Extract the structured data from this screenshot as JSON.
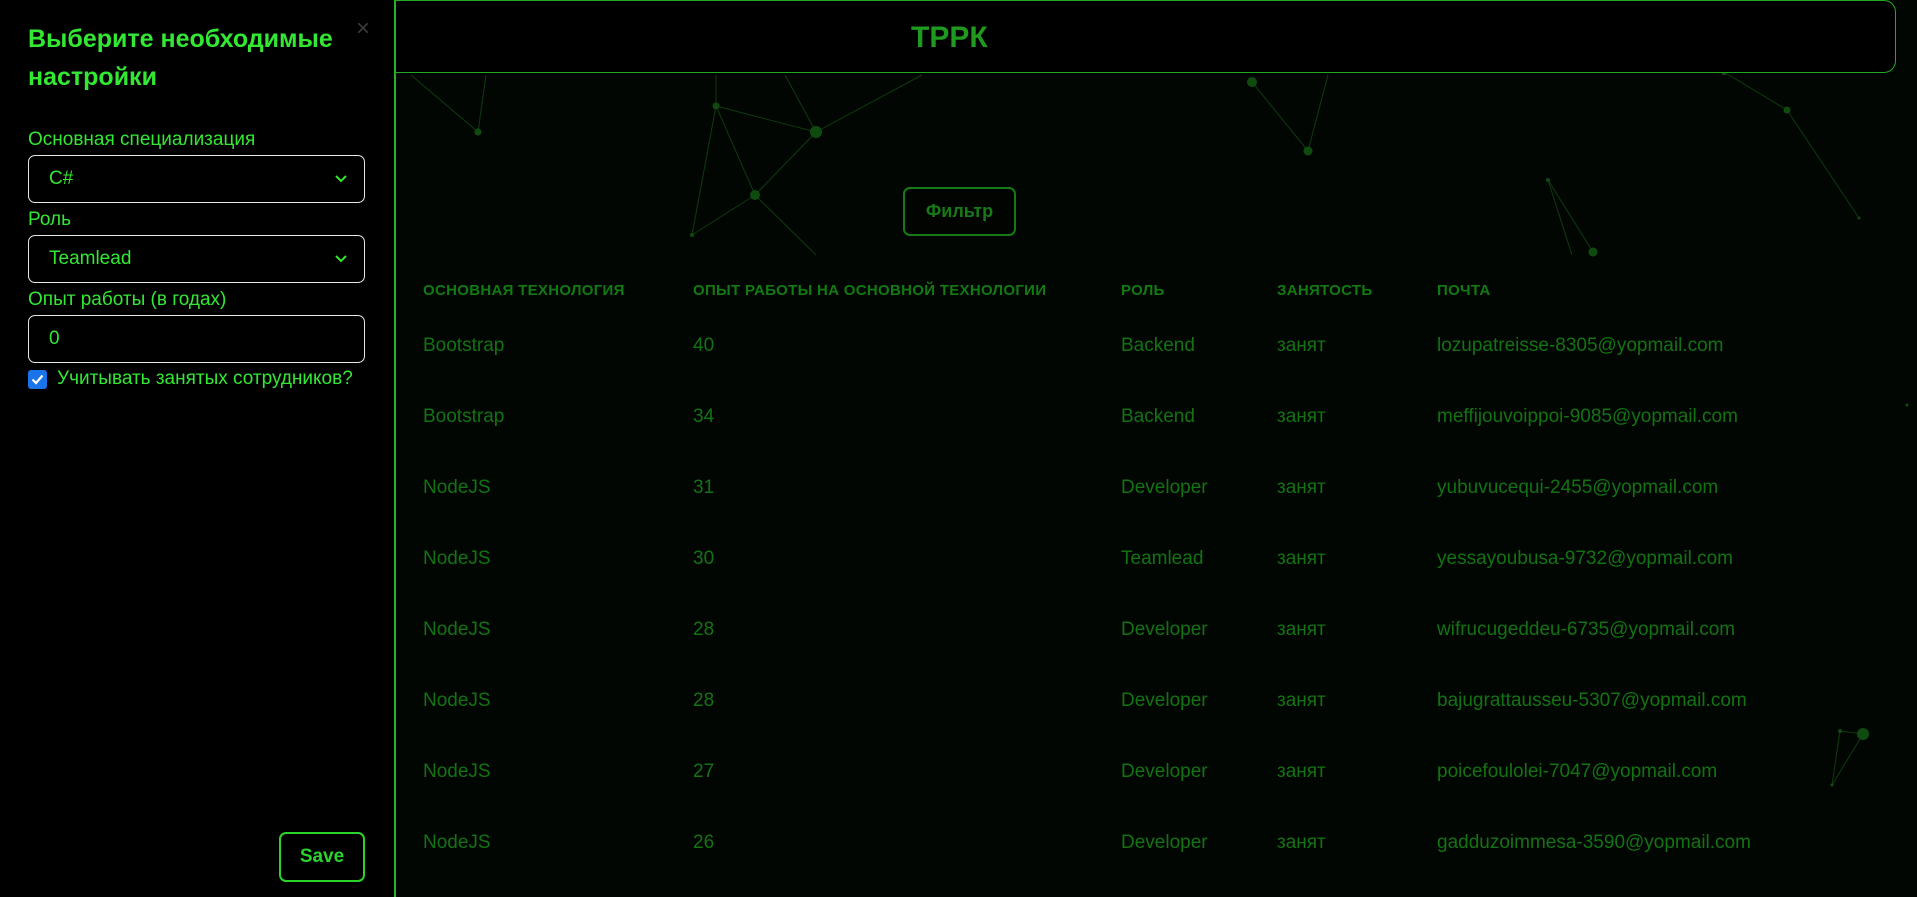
{
  "sidebar": {
    "title": "Выберите необходимые настройки",
    "close_symbol": "×",
    "specialization_label": "Основная специализация",
    "specialization_value": "C#",
    "role_label": "Роль",
    "role_value": "Teamlead",
    "experience_label": "Опыт работы (в годах)",
    "experience_value": "0",
    "include_busy_label": "Учитывать занятых сотрудников?",
    "include_busy_checked": true,
    "save_label": "Save"
  },
  "header": {
    "title": "ТРРК"
  },
  "main": {
    "filter_label": "Фильтр"
  },
  "table": {
    "columns": [
      "ОСНОВНАЯ ТЕХНОЛОГИЯ",
      "ОПЫТ РАБОТЫ НА ОСНОВНОЙ ТЕХНОЛОГИИ",
      "РОЛЬ",
      "ЗАНЯТОСТЬ",
      "ПОЧТА"
    ],
    "rows": [
      {
        "tech": "Bootstrap",
        "exp": "40",
        "role": "Backend",
        "status": "занят",
        "email": "lozupatreisse-8305@yopmail.com"
      },
      {
        "tech": "Bootstrap",
        "exp": "34",
        "role": "Backend",
        "status": "занят",
        "email": "meffijouvoippoi-9085@yopmail.com"
      },
      {
        "tech": "NodeJS",
        "exp": "31",
        "role": "Developer",
        "status": "занят",
        "email": "yubuvucequi-2455@yopmail.com"
      },
      {
        "tech": "NodeJS",
        "exp": "30",
        "role": "Teamlead",
        "status": "занят",
        "email": "yessayoubusa-9732@yopmail.com"
      },
      {
        "tech": "NodeJS",
        "exp": "28",
        "role": "Developer",
        "status": "занят",
        "email": "wifrucugeddeu-6735@yopmail.com"
      },
      {
        "tech": "NodeJS",
        "exp": "28",
        "role": "Developer",
        "status": "занят",
        "email": "bajugrattausseu-5307@yopmail.com"
      },
      {
        "tech": "NodeJS",
        "exp": "27",
        "role": "Developer",
        "status": "занят",
        "email": "poicefoulolei-7047@yopmail.com"
      },
      {
        "tech": "NodeJS",
        "exp": "26",
        "role": "Developer",
        "status": "занят",
        "email": "gadduzoimmesa-3590@yopmail.com"
      }
    ]
  },
  "colors": {
    "accent": "#33e833",
    "table_text": "#137313",
    "background": "#000000"
  }
}
